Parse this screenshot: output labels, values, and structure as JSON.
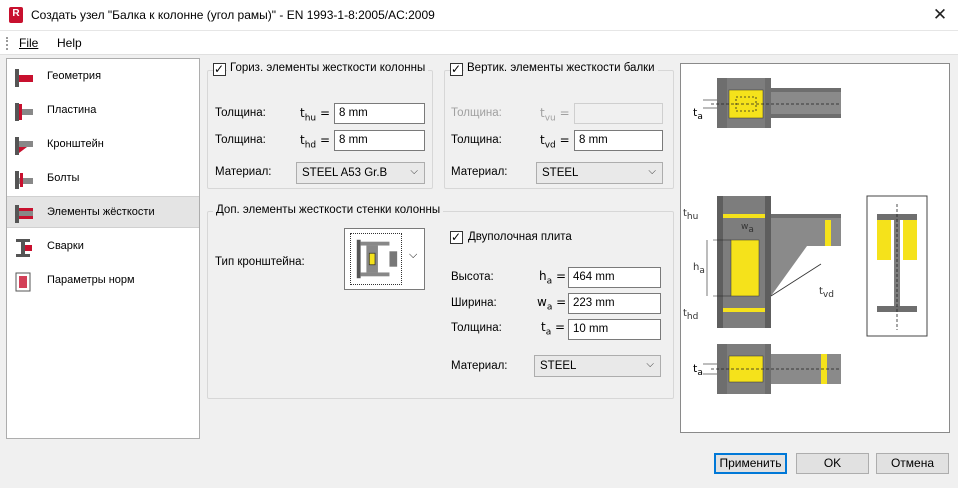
{
  "window": {
    "icon_letter": "R",
    "title": "Создать узел \"Балка к колонне (угол рамы)\" - EN 1993-1-8:2005/AC:2009",
    "close": "✕"
  },
  "menu": {
    "file": "File",
    "help": "Help"
  },
  "nav": {
    "items": [
      {
        "label": "Геометрия",
        "icon": "geometry-icon"
      },
      {
        "label": "Пластина",
        "icon": "plate-icon"
      },
      {
        "label": "Кронштейн",
        "icon": "bracket-icon"
      },
      {
        "label": "Болты",
        "icon": "bolts-icon"
      },
      {
        "label": "Элементы жёсткости",
        "icon": "stiffeners-icon",
        "selected": true
      },
      {
        "label": "Сварки",
        "icon": "welds-icon"
      },
      {
        "label": "Параметры норм",
        "icon": "code-params-icon"
      }
    ]
  },
  "horiz_stiffeners": {
    "title": "Гориз. элементы жесткости колонны",
    "checked": true,
    "thickness1_label": "Толщина:",
    "thickness1_sym": "t",
    "thickness1_sub": "hu",
    "thickness1_value": "8 mm",
    "thickness2_label": "Толщина:",
    "thickness2_sym": "t",
    "thickness2_sub": "hd",
    "thickness2_value": "8 mm",
    "material_label": "Материал:",
    "material_value": "STEEL A53 Gr.B"
  },
  "vert_stiffeners": {
    "title": "Вертик. элементы жесткости балки",
    "checked": true,
    "thickness1_label": "Толщина:",
    "thickness1_sym": "t",
    "thickness1_sub": "vu",
    "thickness1_value": "",
    "thickness2_label": "Толщина:",
    "thickness2_sym": "t",
    "thickness2_sub": "vd",
    "thickness2_value": "8 mm",
    "material_label": "Материал:",
    "material_value": "STEEL"
  },
  "web_stiffeners": {
    "title": "Доп. элементы жесткости стенки колонны",
    "bracket_type_label": "Тип кронштейна:",
    "double_plate_label": "Двуполочная плита",
    "double_plate_checked": true,
    "height_label": "Высота:",
    "height_sym": "h",
    "height_sub": "a",
    "height_value": "464 mm",
    "width_label": "Ширина:",
    "width_sym": "w",
    "width_sub": "a",
    "width_value": "223 mm",
    "thickness_label": "Толщина:",
    "thickness_sym": "t",
    "thickness_sub": "a",
    "thickness_value": "10 mm",
    "material_label": "Материал:",
    "material_value": "STEEL"
  },
  "preview_labels": {
    "ta_top": "t",
    "ta_top_sub": "a",
    "thu": "t",
    "thu_sub": "hu",
    "wa": "w",
    "wa_sub": "a",
    "ha": "h",
    "ha_sub": "a",
    "thd": "t",
    "thd_sub": "hd",
    "tvd": "t",
    "tvd_sub": "vd",
    "ta_bottom": "t",
    "ta_bottom_sub": "a"
  },
  "buttons": {
    "apply": "Применить",
    "ok": "OK",
    "cancel": "Отмена"
  },
  "colors": {
    "steel": "#7d7d7d",
    "stiffener": "#f5e21b",
    "accent": "#0078d7"
  }
}
